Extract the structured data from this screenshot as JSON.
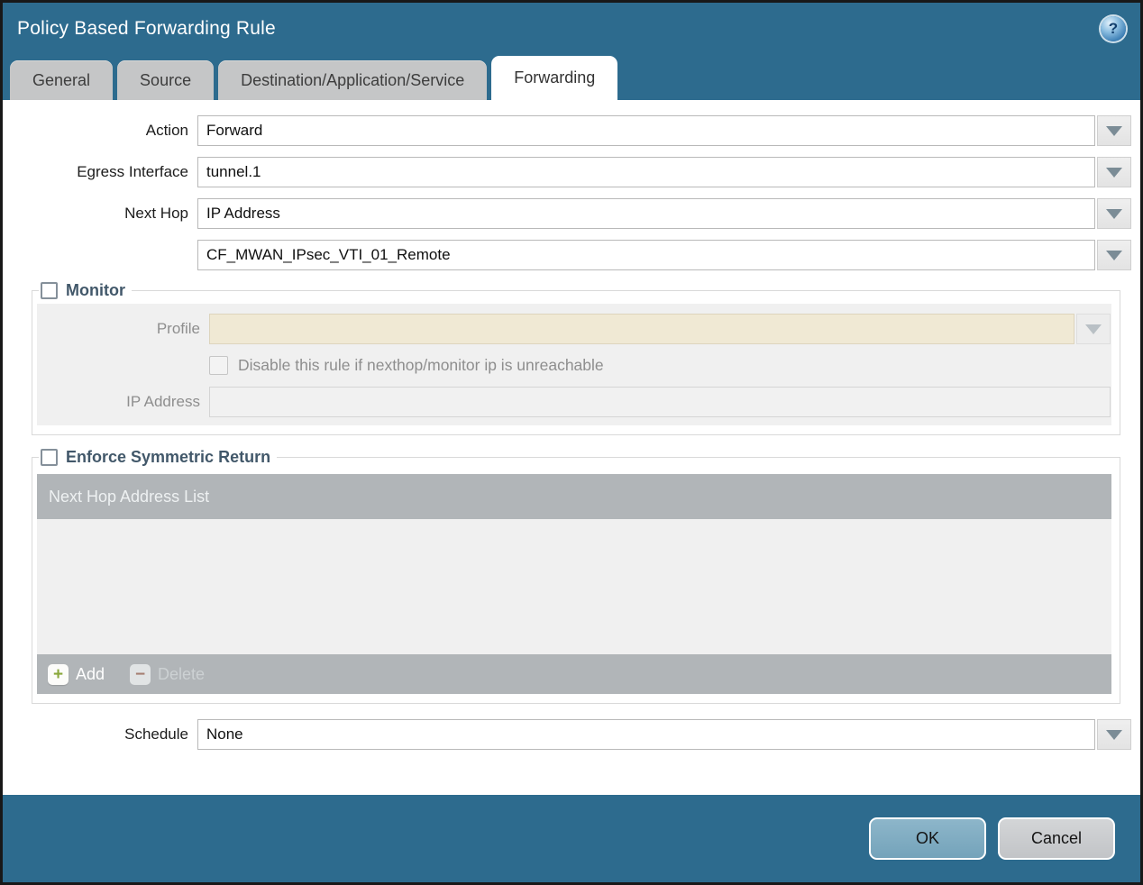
{
  "window": {
    "title": "Policy Based Forwarding Rule"
  },
  "tabs": [
    {
      "label": "General",
      "active": false
    },
    {
      "label": "Source",
      "active": false
    },
    {
      "label": "Destination/Application/Service",
      "active": false
    },
    {
      "label": "Forwarding",
      "active": true
    }
  ],
  "form": {
    "action": {
      "label": "Action",
      "value": "Forward"
    },
    "egress_interface": {
      "label": "Egress Interface",
      "value": "tunnel.1"
    },
    "next_hop": {
      "label": "Next Hop",
      "value": "IP Address"
    },
    "next_hop_address": {
      "value": "CF_MWAN_IPsec_VTI_01_Remote"
    },
    "monitor": {
      "label": "Monitor",
      "checked": false,
      "profile": {
        "label": "Profile",
        "value": ""
      },
      "disable_rule": {
        "label": "Disable this rule if nexthop/monitor ip is unreachable",
        "checked": false
      },
      "ip_address": {
        "label": "IP Address",
        "value": ""
      }
    },
    "enforce_symmetric_return": {
      "label": "Enforce Symmetric Return",
      "checked": false,
      "table": {
        "header": "Next Hop Address List",
        "rows": []
      },
      "add_label": "Add",
      "delete_label": "Delete"
    },
    "schedule": {
      "label": "Schedule",
      "value": "None"
    }
  },
  "footer": {
    "ok_label": "OK",
    "cancel_label": "Cancel"
  },
  "icons": {
    "help_glyph": "?",
    "add_glyph": "+",
    "delete_glyph": "−"
  },
  "colors": {
    "titlebar_teal": "#2d6b8e",
    "active_tab_bg": "#ffffff",
    "inactive_tab_bg": "#c5c6c7",
    "section_label": "#42586a",
    "disabled_field_cream": "#f0e9d4",
    "table_header_gray": "#b1b5b8",
    "ok_button": "#7fadc3",
    "cancel_button": "#cbcdd0",
    "add_plus_green": "#8aa83c",
    "delete_minus_red": "#a57f72"
  }
}
